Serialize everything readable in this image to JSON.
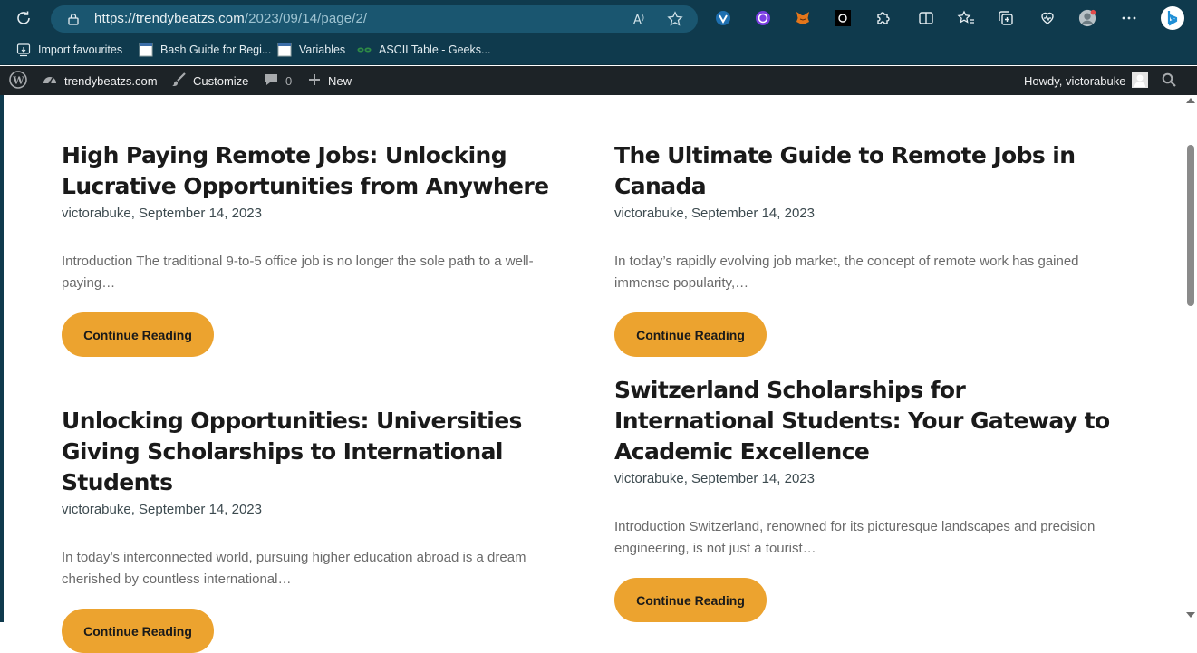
{
  "browser": {
    "url_main": "https://trendybeatzs.com",
    "url_path": "/2023/09/14/page/2/",
    "favourites": [
      {
        "label": "Import favourites"
      },
      {
        "label": "Bash Guide for Begi..."
      },
      {
        "label": "Variables"
      },
      {
        "label": "ASCII Table - Geeks..."
      }
    ]
  },
  "admin_bar": {
    "site_name": "trendybeatzs.com",
    "customize": "Customize",
    "comments_count": "0",
    "new_label": "New",
    "howdy": "Howdy, victorabuke"
  },
  "posts": [
    {
      "title": "High Paying Remote Jobs: Unlocking Lucrative Opportunities from Anywhere",
      "meta": "victorabuke, September 14, 2023",
      "excerpt": "Introduction The traditional 9-to-5 office job is no longer the sole path to a well-paying…",
      "button": "Continue Reading"
    },
    {
      "title": "The Ultimate Guide to Remote Jobs in Canada",
      "meta": "victorabuke, September 14, 2023",
      "excerpt": "In today’s rapidly evolving job market, the concept of remote work has gained immense popularity,…",
      "button": "Continue Reading"
    },
    {
      "title": "Unlocking Opportunities: Universities Giving Scholarships to International Students",
      "meta": "victorabuke, September 14, 2023",
      "excerpt": "In today’s interconnected world, pursuing higher education abroad is a dream cherished by countless international…",
      "button": "Continue Reading"
    },
    {
      "title": "Switzerland Scholarships for International Students: Your Gateway to Academic Excellence",
      "meta": "victorabuke, September 14, 2023",
      "excerpt": "Introduction Switzerland, renowned for its picturesque landscapes and precision engineering, is not just a tourist…",
      "button": "Continue Reading"
    }
  ],
  "colors": {
    "chrome_bg": "#0f3a4d",
    "admin_bar_bg": "#1d2327",
    "button_bg": "#eca32f"
  }
}
